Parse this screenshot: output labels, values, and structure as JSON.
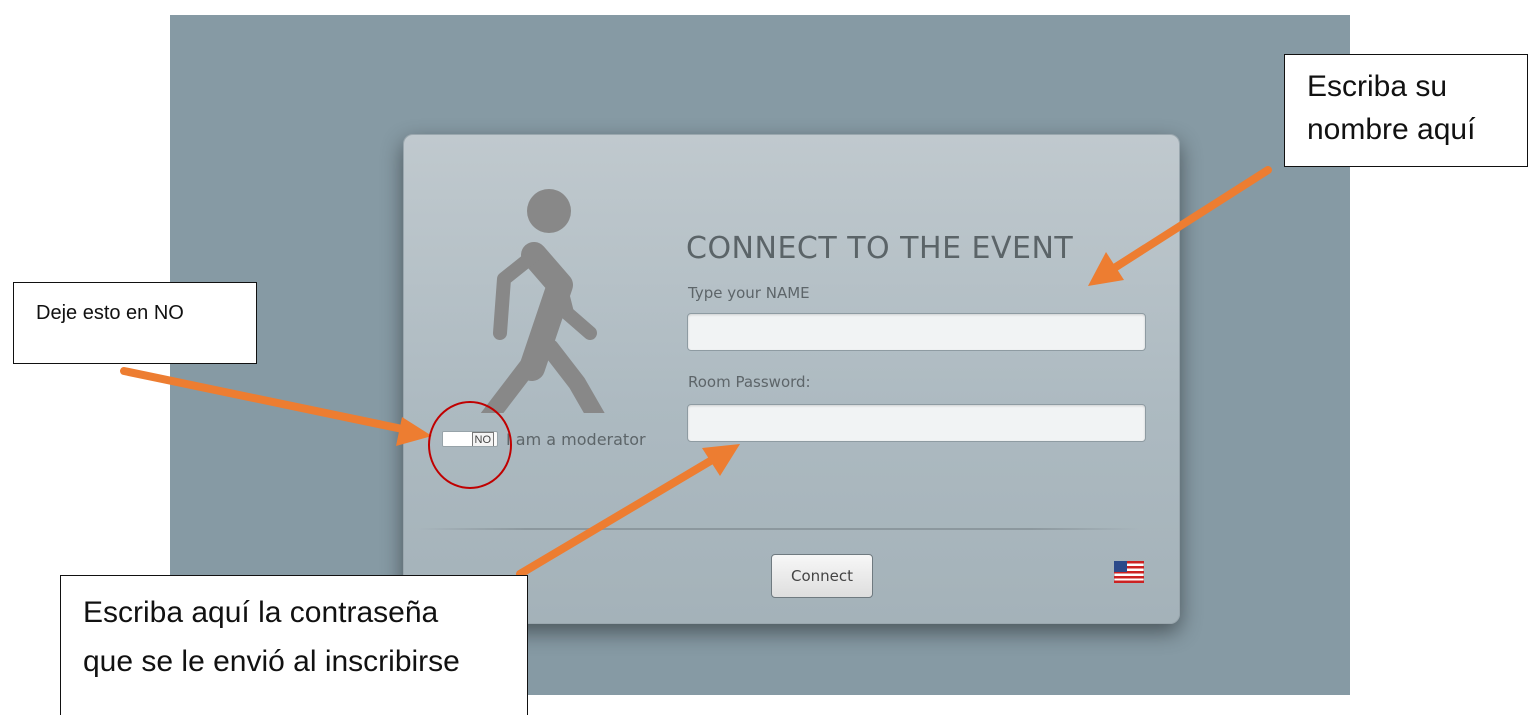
{
  "dialog": {
    "heading": "CONNECT TO THE EVENT",
    "name_label": "Type your NAME",
    "name_value": "",
    "password_label": "Room Password:",
    "password_value": "",
    "moderator_toggle_state": "NO",
    "moderator_label": "I am a moderator",
    "connect_button": "Connect",
    "language_icon": "us-flag-icon"
  },
  "annotations": {
    "name_callout": [
      "Escriba su",
      "nombre aquí"
    ],
    "toggle_callout": "Deje esto en NO",
    "password_callout": [
      "Escriba aquí la contraseña",
      "que se le envió al inscribirse"
    ],
    "arrow_color": "#ed7d31",
    "circle_color": "#c00000"
  },
  "colors": {
    "background": "#869aa4",
    "dialog": "#b0bcc2",
    "heading_text": "#5b6468",
    "figure": "#888888"
  }
}
